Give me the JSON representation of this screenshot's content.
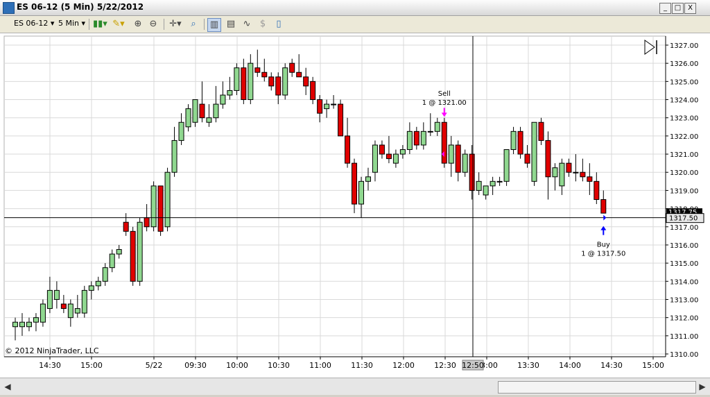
{
  "window": {
    "title": "ES 06-12 (5 Min)  5/22/2012",
    "buttons": [
      "_",
      "□",
      "X"
    ]
  },
  "toolbar": {
    "instrument": "ES 06-12",
    "interval": "5 Min",
    "icons": [
      "bar-type-icon",
      "draw-tool-icon",
      "zoom-in-icon",
      "zoom-out-icon",
      "crosshair-icon",
      "search-icon",
      "chart-style-icon",
      "strategy-icon",
      "indicator-icon",
      "properties-icon",
      "template-icon"
    ]
  },
  "chart": {
    "copyright": "© 2012 NinjaTrader, LLC",
    "crosshair_time_label": "12:50",
    "crosshair_price_label": "1317.50",
    "last_price_label": "1317.75",
    "scroll_end_icon": "scroll-to-end-icon",
    "colors": {
      "up": "#90d890",
      "down": "#e00000",
      "grid": "#d9d9d9",
      "buy": "#0000ff",
      "sell": "#ff00ff"
    }
  },
  "chart_data": {
    "type": "candlestick",
    "xticks": [
      "14:30",
      "15:00",
      "5/22",
      "09:30",
      "10:00",
      "10:30",
      "11:00",
      "11:30",
      "12:00",
      "12:30",
      "13:00",
      "13:30",
      "14:00",
      "14:30",
      "15:00"
    ],
    "yticks": [
      "1310.00",
      "1311.00",
      "1312.00",
      "1313.00",
      "1314.00",
      "1315.00",
      "1316.00",
      "1317.00",
      "1318.00",
      "1319.00",
      "1320.00",
      "1321.00",
      "1322.00",
      "1323.00",
      "1324.00",
      "1325.00",
      "1326.00",
      "1327.00"
    ],
    "ylim": [
      1310,
      1327
    ],
    "candles": [
      [
        1311.5,
        1312.0,
        1310.75,
        1311.75
      ],
      [
        1311.5,
        1312.25,
        1311.0,
        1311.75
      ],
      [
        1311.5,
        1312.0,
        1311.25,
        1311.75
      ],
      [
        1311.75,
        1312.25,
        1311.25,
        1312.0
      ],
      [
        1311.75,
        1313.0,
        1311.5,
        1312.75
      ],
      [
        1312.5,
        1314.25,
        1312.25,
        1313.5
      ],
      [
        1313.0,
        1314.0,
        1312.5,
        1313.5
      ],
      [
        1312.75,
        1313.25,
        1312.25,
        1312.5
      ],
      [
        1312.0,
        1313.0,
        1311.5,
        1312.75
      ],
      [
        1312.25,
        1313.25,
        1312.0,
        1312.5
      ],
      [
        1312.25,
        1313.75,
        1312.0,
        1313.5
      ],
      [
        1313.5,
        1314.0,
        1313.0,
        1313.75
      ],
      [
        1313.75,
        1314.25,
        1313.5,
        1314.0
      ],
      [
        1314.0,
        1315.0,
        1313.75,
        1314.75
      ],
      [
        1314.75,
        1315.75,
        1314.5,
        1315.5
      ],
      [
        1315.5,
        1316.0,
        1315.25,
        1315.75
      ],
      [
        1317.25,
        1317.75,
        1316.5,
        1316.75
      ],
      [
        1316.75,
        1317.0,
        1313.75,
        1314.0
      ],
      [
        1314.0,
        1317.5,
        1313.75,
        1317.25
      ],
      [
        1317.5,
        1318.25,
        1316.75,
        1317.0
      ],
      [
        1317.0,
        1319.5,
        1316.75,
        1319.25
      ],
      [
        1319.25,
        1319.25,
        1316.5,
        1316.75
      ],
      [
        1317.0,
        1320.25,
        1316.75,
        1320.0
      ],
      [
        1320.0,
        1322.5,
        1319.75,
        1321.75
      ],
      [
        1321.75,
        1323.25,
        1321.5,
        1322.75
      ],
      [
        1322.5,
        1323.75,
        1322.25,
        1323.5
      ],
      [
        1322.75,
        1324.0,
        1322.5,
        1324.0
      ],
      [
        1323.75,
        1325.0,
        1322.75,
        1323.0
      ],
      [
        1322.75,
        1323.75,
        1322.5,
        1323.0
      ],
      [
        1323.0,
        1324.75,
        1322.75,
        1323.75
      ],
      [
        1323.75,
        1325.0,
        1323.5,
        1324.25
      ],
      [
        1324.25,
        1325.25,
        1324.0,
        1324.5
      ],
      [
        1324.5,
        1326.0,
        1324.25,
        1325.75
      ],
      [
        1325.75,
        1326.25,
        1323.75,
        1324.0
      ],
      [
        1324.0,
        1326.5,
        1323.75,
        1326.0
      ],
      [
        1325.75,
        1326.75,
        1325.25,
        1325.5
      ],
      [
        1325.5,
        1326.25,
        1325.0,
        1325.25
      ],
      [
        1325.25,
        1325.5,
        1324.5,
        1324.75
      ],
      [
        1325.25,
        1325.5,
        1323.75,
        1324.25
      ],
      [
        1324.25,
        1326.0,
        1324.0,
        1325.75
      ],
      [
        1326.0,
        1326.25,
        1325.25,
        1325.5
      ],
      [
        1325.5,
        1326.5,
        1325.25,
        1325.25
      ],
      [
        1325.25,
        1325.75,
        1324.25,
        1324.75
      ],
      [
        1325.0,
        1325.25,
        1323.75,
        1324.0
      ],
      [
        1324.0,
        1324.25,
        1322.75,
        1323.25
      ],
      [
        1323.5,
        1324.0,
        1323.0,
        1323.75
      ],
      [
        1323.75,
        1324.25,
        1323.5,
        1323.75
      ],
      [
        1323.75,
        1324.0,
        1322.75,
        1322.0
      ],
      [
        1322.0,
        1323.0,
        1320.25,
        1320.5
      ],
      [
        1320.5,
        1320.75,
        1317.75,
        1318.25
      ],
      [
        1318.25,
        1319.75,
        1317.5,
        1319.5
      ],
      [
        1319.5,
        1320.25,
        1319.0,
        1319.75
      ],
      [
        1320.0,
        1321.75,
        1319.5,
        1321.5
      ],
      [
        1321.5,
        1321.75,
        1320.75,
        1321.0
      ],
      [
        1321.0,
        1322.0,
        1320.5,
        1320.75
      ],
      [
        1320.5,
        1321.25,
        1320.25,
        1321.0
      ],
      [
        1321.0,
        1321.5,
        1320.75,
        1321.25
      ],
      [
        1321.25,
        1322.75,
        1321.0,
        1322.25
      ],
      [
        1322.25,
        1322.5,
        1321.25,
        1321.5
      ],
      [
        1321.5,
        1322.75,
        1321.25,
        1322.25
      ],
      [
        1322.25,
        1323.25,
        1322.0,
        1322.25
      ],
      [
        1322.25,
        1323.0,
        1322.0,
        1322.75
      ],
      [
        1322.75,
        1323.0,
        1320.25,
        1320.5
      ],
      [
        1320.5,
        1322.0,
        1319.75,
        1321.5
      ],
      [
        1321.5,
        1321.75,
        1319.5,
        1320.0
      ],
      [
        1320.0,
        1321.25,
        1319.75,
        1321.0
      ],
      [
        1321.0,
        1321.5,
        1318.5,
        1319.0
      ],
      [
        1319.0,
        1320.0,
        1318.75,
        1319.5
      ],
      [
        1318.75,
        1319.0,
        1318.5,
        1319.25
      ],
      [
        1319.25,
        1319.75,
        1318.75,
        1319.5
      ],
      [
        1319.5,
        1319.75,
        1319.25,
        1319.5
      ],
      [
        1319.5,
        1321.25,
        1319.25,
        1321.25
      ],
      [
        1321.25,
        1322.5,
        1321.0,
        1322.25
      ],
      [
        1322.25,
        1322.5,
        1320.75,
        1321.0
      ],
      [
        1321.0,
        1321.5,
        1320.25,
        1320.5
      ],
      [
        1319.5,
        1322.75,
        1319.25,
        1322.75
      ],
      [
        1322.75,
        1323.0,
        1321.5,
        1321.75
      ],
      [
        1321.75,
        1322.25,
        1318.5,
        1319.75
      ],
      [
        1319.75,
        1320.5,
        1319.0,
        1320.25
      ],
      [
        1319.25,
        1320.75,
        1318.75,
        1320.5
      ],
      [
        1320.5,
        1320.75,
        1319.75,
        1320.0
      ],
      [
        1320.0,
        1321.0,
        1319.5,
        1320.0
      ],
      [
        1320.0,
        1320.75,
        1319.5,
        1319.75
      ],
      [
        1319.75,
        1320.5,
        1318.75,
        1319.5
      ],
      [
        1319.5,
        1320.0,
        1318.25,
        1318.5
      ],
      [
        1318.5,
        1319.0,
        1317.75,
        1317.75
      ]
    ],
    "executions": [
      {
        "side": "Sell",
        "label": "Sell",
        "detail": "1 @ 1321.00",
        "price": 1321.0,
        "bar": 62
      },
      {
        "side": "Buy",
        "label": "Buy",
        "detail": "1 @ 1317.50",
        "price": 1317.5,
        "bar": 85
      }
    ]
  }
}
